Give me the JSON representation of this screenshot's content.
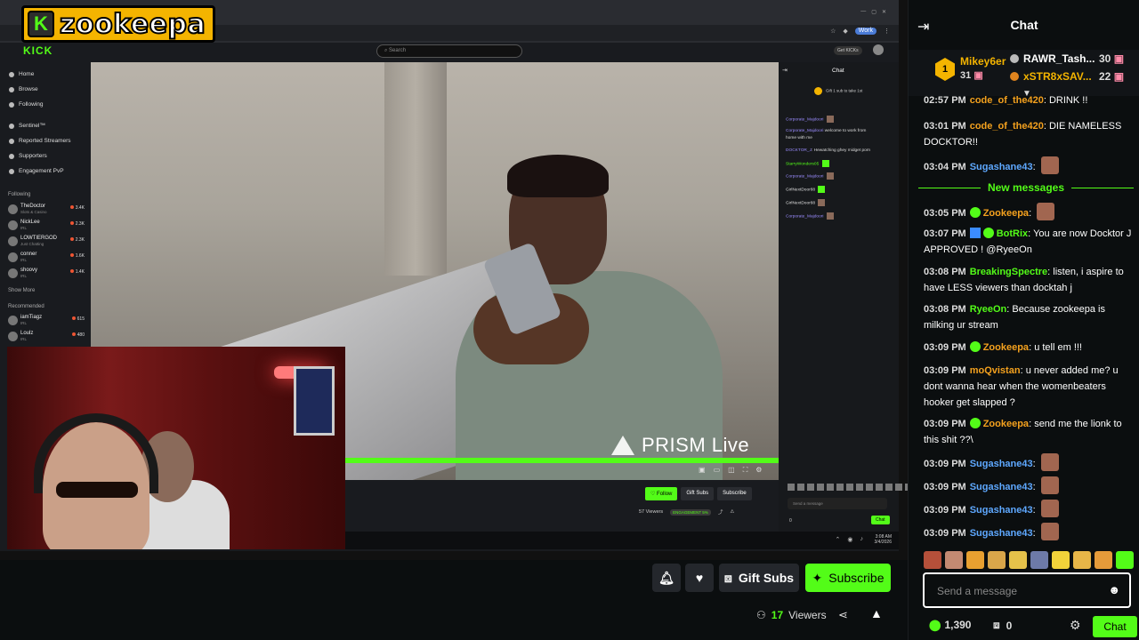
{
  "overlay": {
    "logo_text": "zookeepa",
    "logo_letter": "K"
  },
  "kick": {
    "brand": "KICK",
    "search_placeholder": "Search",
    "get_kicks": "Get KICKs",
    "nav": [
      "Home",
      "Browse",
      "Following"
    ],
    "nav2": [
      "Sentinel™",
      "Reported Streamers",
      "Supporters",
      "Engagement PvP"
    ],
    "following_label": "Following",
    "following": [
      {
        "name": "TheDoctor",
        "sub": "Slots & Casino",
        "viewers": "3.4K"
      },
      {
        "name": "NickLee",
        "sub": "IRL",
        "viewers": "2.3K"
      },
      {
        "name": "LOWTIERGOD",
        "sub": "Just Chatting",
        "viewers": "2.3K"
      },
      {
        "name": "conner",
        "sub": "IRL",
        "viewers": "1.6K"
      },
      {
        "name": "shoovy",
        "sub": "IRL",
        "viewers": "1.4K"
      }
    ],
    "show_more": "Show More",
    "recommended_label": "Recommended",
    "recommended": [
      {
        "name": "iamTiagz",
        "sub": "IRL",
        "viewers": "615"
      },
      {
        "name": "Loulz",
        "sub": "IRL",
        "viewers": "480"
      }
    ],
    "chat_title": "Chat",
    "gift_line": "Gift 1 sub to take 1st",
    "chat_msgs": [
      {
        "user": "Corporate_Majdoori",
        "text": ""
      },
      {
        "user": "Corporate_Majdoori",
        "text": "welcome to work from"
      },
      {
        "user": "",
        "text": "home with me"
      },
      {
        "user": "DOCKTOR_J",
        "text": "Hewatching ghey midget porn"
      },
      {
        "user": "StarryWonders05",
        "text": ""
      },
      {
        "user": "Corporate_Majdoori",
        "text": ""
      },
      {
        "user": "GirlNextDoor88",
        "text": ""
      },
      {
        "user": "GirlNextDoor88",
        "text": ""
      },
      {
        "user": "Corporate_Majdoori",
        "text": ""
      }
    ],
    "send_placeholder": "Send a message",
    "chat_btn": "Chat",
    "counts": "0",
    "follow": "Follow",
    "gift_subs": "Gift Subs",
    "subscribe": "Subscribe",
    "viewers": "57 Viewers",
    "engagement": "ENGAGEMENT",
    "engagement_pct": "5%",
    "prism": "PRISM Live",
    "clock_time": "3:08 AM",
    "clock_date": "3/4/2026"
  },
  "below": {
    "gift_subs": "Gift Subs",
    "subscribe": "Subscribe",
    "viewers_count": "17",
    "viewers_label": "Viewers"
  },
  "chat": {
    "title": "Chat",
    "top_gifter": {
      "rank": "1",
      "name": "Mikey6er",
      "count": "31"
    },
    "gifters": [
      {
        "name": "RAWR_Tash...",
        "count": "30"
      },
      {
        "name": "xSTR8xSAV...",
        "count": "22"
      }
    ],
    "messages": [
      {
        "time": "02:57 PM",
        "user": "code_of_the420",
        "text": "DRINK !!"
      },
      {
        "time": "03:01 PM",
        "user": "code_of_the420",
        "text": "DIE NAMELESS DOCKTOR!!"
      },
      {
        "time": "03:04 PM",
        "user": "Sugashane43",
        "text": ""
      },
      {
        "time": "03:05 PM",
        "user": "Zookeepa",
        "text": ""
      },
      {
        "time": "03:07 PM",
        "user": "BotRix",
        "text": "You are now Docktor J APPROVED ! @RyeeOn"
      },
      {
        "time": "03:08 PM",
        "user": "BreakingSpectre",
        "text": "listen, i aspire to have LESS viewers than docktah j"
      },
      {
        "time": "03:08 PM",
        "user": "RyeeOn",
        "text": "Because zookeepa is milking ur stream"
      },
      {
        "time": "03:09 PM",
        "user": "Zookeepa",
        "text": "u tell em !!!"
      },
      {
        "time": "03:09 PM",
        "user": "moQvistan",
        "text": "u never added me? u dont wanna hear when the womenbeaters hooker get slapped ?"
      },
      {
        "time": "03:09 PM",
        "user": "Zookeepa",
        "text": "send me the lionk to this shit ??\\"
      },
      {
        "time": "03:09 PM",
        "user": "Sugashane43",
        "text": ""
      },
      {
        "time": "03:09 PM",
        "user": "Sugashane43",
        "text": ""
      },
      {
        "time": "03:09 PM",
        "user": "Sugashane43",
        "text": ""
      },
      {
        "time": "03:09 PM",
        "user": "Sugashane43",
        "text": ""
      }
    ],
    "new_messages": "New messages",
    "input_placeholder": "Send a message",
    "points": "1,390",
    "gift_count": "0",
    "send_label": "Chat"
  },
  "colors": {
    "accent": "#53fc18",
    "gold": "#f4b400",
    "username_blue": "#5ea8ff"
  }
}
